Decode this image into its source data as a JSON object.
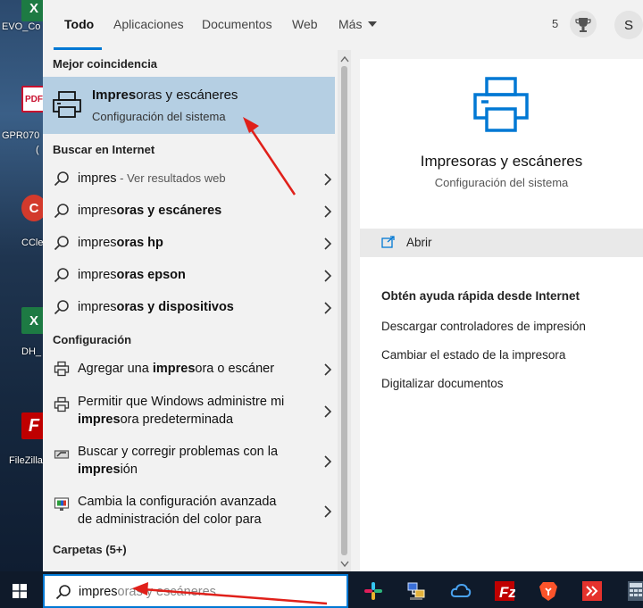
{
  "desktop": {
    "icons": [
      {
        "label": "EVO_Co",
        "kind": "excel"
      },
      {
        "label": "GPR070",
        "kind": "pdf"
      },
      {
        "label": "(",
        "kind": "pdf-sub"
      },
      {
        "label": "CCle",
        "kind": "ccleaner"
      },
      {
        "label": "DH_",
        "kind": "excel"
      },
      {
        "label": "FileZilla",
        "kind": "filezilla"
      }
    ]
  },
  "tabs": [
    {
      "label": "Todo",
      "active": true
    },
    {
      "label": "Aplicaciones",
      "active": false
    },
    {
      "label": "Documentos",
      "active": false
    },
    {
      "label": "Web",
      "active": false
    },
    {
      "label": "Más",
      "active": false
    }
  ],
  "header": {
    "points": "5",
    "avatar_initial": "S"
  },
  "sections": {
    "best": "Mejor coincidencia",
    "web": "Buscar en Internet",
    "config": "Configuración",
    "folders": "Carpetas (5+)"
  },
  "best_match": {
    "title_bold": "Impres",
    "title_rest": "oras y escáneres",
    "subtitle": "Configuración del sistema"
  },
  "web_results": [
    {
      "prefix": "impres",
      "rest": "",
      "hint": " - Ver resultados web"
    },
    {
      "prefix": "impres",
      "rest": "oras y escáneres",
      "hint": ""
    },
    {
      "prefix": "impres",
      "rest": "oras hp",
      "hint": ""
    },
    {
      "prefix": "impres",
      "rest": "oras epson",
      "hint": ""
    },
    {
      "prefix": "impres",
      "rest": "oras y dispositivos",
      "hint": ""
    }
  ],
  "config_results": [
    {
      "line1_a": "Agregar una ",
      "line1_b": "impres",
      "line1_c": "ora o escáner",
      "line2_a": "",
      "line2_b": "",
      "line2_c": ""
    },
    {
      "line1_a": "Permitir que Windows administre mi",
      "line1_b": "",
      "line1_c": "",
      "line2_a": "",
      "line2_b": "impres",
      "line2_c": "ora predeterminada"
    },
    {
      "line1_a": "Buscar y corregir problemas con la",
      "line1_b": "",
      "line1_c": "",
      "line2_a": "",
      "line2_b": "impres",
      "line2_c": "ión"
    },
    {
      "line1_a": "Cambia la configuración avanzada",
      "line1_b": "",
      "line1_c": "",
      "line2_a": "de administración del color para",
      "line2_b": "",
      "line2_c": ""
    }
  ],
  "preview": {
    "title": "Impresoras y escáneres",
    "subtitle": "Configuración del sistema",
    "open_label": "Abrir",
    "help_title": "Obtén ayuda rápida desde Internet",
    "help_links": [
      "Descargar controladores de impresión",
      "Cambiar el estado de la impresora",
      "Digitalizar documentos"
    ]
  },
  "search": {
    "typed": "impres",
    "suggestion": "oras y escáneres"
  },
  "colors": {
    "accent": "#0078d4",
    "highlight": "#b5cfe3",
    "annotation": "#e0201a"
  }
}
